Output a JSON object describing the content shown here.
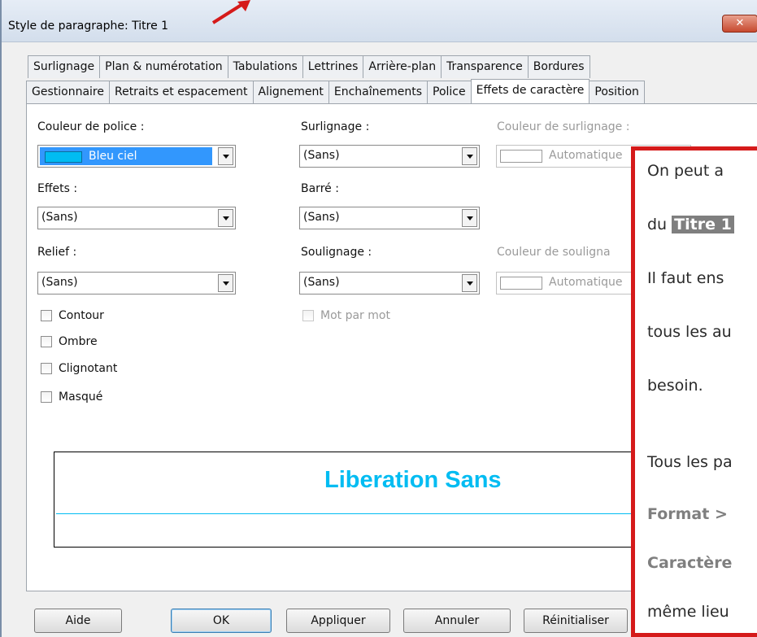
{
  "window": {
    "title": "Style de paragraphe: Titre 1",
    "close_label": "✕"
  },
  "tabs": {
    "row1": [
      "Surlignage",
      "Plan & numérotation",
      "Tabulations",
      "Lettrines",
      "Arrière-plan",
      "Transparence",
      "Bordures"
    ],
    "row2": [
      "Gestionnaire",
      "Retraits et espacement",
      "Alignement",
      "Enchaînements",
      "Police",
      "Effets de caractère",
      "Position"
    ],
    "active": "Effets de caractère"
  },
  "fields": {
    "font_color_label": "Couleur de police :",
    "font_color_value": "Bleu ciel",
    "font_color_swatch": "#00bcf2",
    "overline_label": "Surlignage :",
    "overline_value": "(Sans)",
    "overline_color_label": "Couleur de surlignage :",
    "overline_color_value": "Automatique",
    "effects_label": "Effets :",
    "effects_value": "(Sans)",
    "strikethrough_label": "Barré :",
    "strikethrough_value": "(Sans)",
    "relief_label": "Relief :",
    "relief_value": "(Sans)",
    "underline_label": "Soulignage :",
    "underline_value": "(Sans)",
    "underline_color_label": "Couleur de souligna",
    "underline_color_value": "Automatique"
  },
  "checkboxes": {
    "contour": "Contour",
    "shadow": "Ombre",
    "blink": "Clignotant",
    "hidden": "Masqué",
    "word_by_word": "Mot par mot"
  },
  "preview": {
    "text": "Liberation Sans",
    "color": "#00bcf2"
  },
  "buttons": {
    "help": "Aide",
    "ok": "OK",
    "apply": "Appliquer",
    "cancel": "Annuler",
    "reset": "Réinitialiser"
  },
  "overlay": {
    "line1": "On peut a",
    "line2_prefix": "du ",
    "line2_highlight": "Titre 1",
    "line3": "Il faut ens",
    "line4": "tous les au",
    "line5": "besoin.",
    "line6": "Tous les pa",
    "line7": "Format > ",
    "line8": "Caractère",
    "line9": "même lieu",
    "border_color": "#d51a1a"
  }
}
